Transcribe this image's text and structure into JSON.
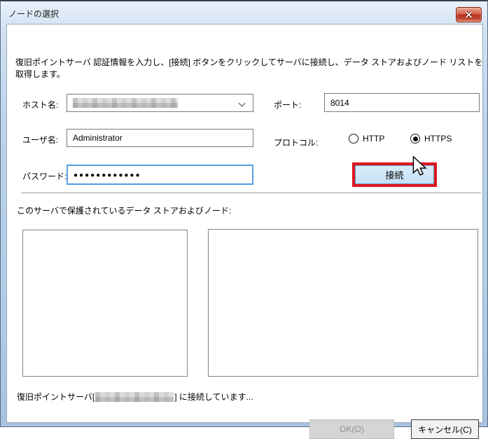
{
  "window": {
    "title": "ノードの選択"
  },
  "description": "復旧ポイントサーバ 認証情報を入力し、[接続] ボタンをクリックしてサーバに接続し、データ ストアおよびノード リストを取得します。",
  "form": {
    "host_label": "ホスト名:",
    "host_value_redacted": true,
    "port_label": "ポート:",
    "port_value": "8014",
    "user_label": "ユーザ名:",
    "user_value": "Administrator",
    "protocol_label": "プロトコル:",
    "protocol_options": [
      {
        "label": "HTTP",
        "selected": false
      },
      {
        "label": "HTTPS",
        "selected": true
      }
    ],
    "password_label": "パスワード:",
    "password_value_masked": "●●●●●●●●●●●●",
    "connect_button": "接続"
  },
  "section_label": "このサーバで保護されているデータ ストアおよびノード:",
  "lists": {
    "left_items": [],
    "right_items": []
  },
  "status": {
    "prefix": "復旧ポイントサーバ[",
    "server_redacted": true,
    "suffix": "] に接続しています..."
  },
  "footer": {
    "ok_label": "OK(O)",
    "ok_enabled": false,
    "cancel_label": "キャンセル(C)"
  },
  "colors": {
    "annotation_red": "#e0161f",
    "titlebar_blue": "#b9cfe8",
    "focus_border": "#569de5",
    "connect_bg": "#cde5f7"
  }
}
